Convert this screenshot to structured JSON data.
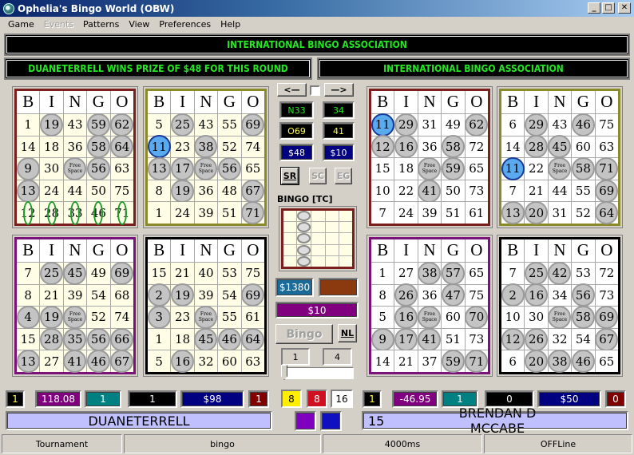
{
  "window": {
    "title": "Ophelia's Bingo World (OBW)",
    "controls": [
      "_",
      "□",
      "✕"
    ]
  },
  "menu": [
    {
      "label": "Game",
      "enabled": true
    },
    {
      "label": "Events",
      "enabled": false
    },
    {
      "label": "Patterns",
      "enabled": true
    },
    {
      "label": "View",
      "enabled": true
    },
    {
      "label": "Preferences",
      "enabled": true
    },
    {
      "label": "Help",
      "enabled": true
    }
  ],
  "banners": {
    "top": "INTERNATIONAL BINGO ASSOCIATION",
    "left": "DUANETERRELL   WINS PRIZE OF $48 FOR THIS ROUND",
    "right": "INTERNATIONAL BINGO ASSOCIATION"
  },
  "colors": {
    "banner_text": "#22e822",
    "card_dark_red": "#7a1e1e",
    "card_olive": "#8a8a2a",
    "card_purple": "#7a127a",
    "card_black": "#000000",
    "marked_ball": "#c4c4c4",
    "called_ball": "#5aaaf0"
  },
  "bingo_header": [
    "B",
    "I",
    "N",
    "G",
    "O"
  ],
  "free_space_label": "Free Space",
  "cards": [
    {
      "id": "left-1",
      "border": "#7a1e1e",
      "style": "cream",
      "rows": [
        [
          1,
          19,
          43,
          59,
          62
        ],
        [
          14,
          18,
          36,
          58,
          64
        ],
        [
          9,
          30,
          "FREE",
          56,
          63
        ],
        [
          13,
          24,
          44,
          50,
          75
        ],
        [
          12,
          28,
          33,
          46,
          71
        ]
      ],
      "marked": [
        [
          0,
          1
        ],
        [
          0,
          3
        ],
        [
          0,
          4
        ],
        [
          1,
          3
        ],
        [
          1,
          4
        ],
        [
          2,
          0
        ],
        [
          2,
          2
        ],
        [
          2,
          3
        ],
        [
          3,
          0
        ]
      ],
      "called": [],
      "winning_row": 4
    },
    {
      "id": "left-2",
      "border": "#8a8a2a",
      "style": "cream",
      "rows": [
        [
          5,
          25,
          43,
          55,
          69
        ],
        [
          11,
          23,
          38,
          52,
          74
        ],
        [
          13,
          17,
          "FREE",
          56,
          65
        ],
        [
          8,
          19,
          36,
          48,
          67
        ],
        [
          1,
          24,
          39,
          51,
          71
        ]
      ],
      "marked": [
        [
          0,
          1
        ],
        [
          0,
          4
        ],
        [
          1,
          2
        ],
        [
          2,
          0
        ],
        [
          2,
          1
        ],
        [
          2,
          2
        ],
        [
          2,
          3
        ],
        [
          3,
          1
        ],
        [
          3,
          4
        ],
        [
          4,
          4
        ]
      ],
      "called": [
        [
          1,
          0
        ]
      ],
      "winning_row": null
    },
    {
      "id": "left-3",
      "border": "#7a127a",
      "style": "cream",
      "rows": [
        [
          7,
          25,
          45,
          49,
          69
        ],
        [
          8,
          21,
          39,
          54,
          68
        ],
        [
          4,
          19,
          "FREE",
          52,
          74
        ],
        [
          15,
          28,
          35,
          56,
          66
        ],
        [
          13,
          27,
          41,
          46,
          67
        ]
      ],
      "marked": [
        [
          0,
          1
        ],
        [
          0,
          2
        ],
        [
          0,
          4
        ],
        [
          2,
          0
        ],
        [
          2,
          1
        ],
        [
          2,
          2
        ],
        [
          3,
          1
        ],
        [
          3,
          2
        ],
        [
          3,
          3
        ],
        [
          3,
          4
        ],
        [
          4,
          0
        ],
        [
          4,
          2
        ],
        [
          4,
          3
        ],
        [
          4,
          4
        ]
      ],
      "called": [],
      "winning_row": null
    },
    {
      "id": "left-4",
      "border": "#000000",
      "style": "cream",
      "rows": [
        [
          15,
          21,
          40,
          53,
          75
        ],
        [
          2,
          19,
          39,
          54,
          69
        ],
        [
          3,
          23,
          "FREE",
          55,
          61
        ],
        [
          1,
          18,
          45,
          46,
          64
        ],
        [
          5,
          16,
          32,
          60,
          63
        ]
      ],
      "marked": [
        [
          1,
          0
        ],
        [
          1,
          1
        ],
        [
          1,
          4
        ],
        [
          2,
          0
        ],
        [
          2,
          2
        ],
        [
          3,
          2
        ],
        [
          3,
          3
        ],
        [
          3,
          4
        ],
        [
          4,
          1
        ]
      ],
      "called": [],
      "winning_row": null
    },
    {
      "id": "right-1",
      "border": "#7a1e1e",
      "style": "white",
      "rows": [
        [
          11,
          29,
          31,
          49,
          62
        ],
        [
          12,
          16,
          36,
          58,
          72
        ],
        [
          15,
          18,
          "FREE",
          59,
          65
        ],
        [
          10,
          22,
          41,
          50,
          73
        ],
        [
          7,
          24,
          39,
          51,
          61
        ]
      ],
      "marked": [
        [
          0,
          1
        ],
        [
          0,
          4
        ],
        [
          1,
          0
        ],
        [
          1,
          1
        ],
        [
          1,
          3
        ],
        [
          2,
          2
        ],
        [
          2,
          3
        ],
        [
          3,
          2
        ]
      ],
      "called": [
        [
          0,
          0
        ]
      ],
      "winning_row": null
    },
    {
      "id": "right-2",
      "border": "#8a8a2a",
      "style": "white",
      "rows": [
        [
          6,
          29,
          43,
          46,
          75
        ],
        [
          14,
          28,
          45,
          60,
          63
        ],
        [
          11,
          22,
          "FREE",
          58,
          71
        ],
        [
          7,
          21,
          44,
          55,
          69
        ],
        [
          13,
          20,
          31,
          52,
          64
        ]
      ],
      "marked": [
        [
          0,
          1
        ],
        [
          0,
          3
        ],
        [
          1,
          1
        ],
        [
          1,
          2
        ],
        [
          2,
          2
        ],
        [
          2,
          3
        ],
        [
          2,
          4
        ],
        [
          3,
          4
        ],
        [
          4,
          0
        ],
        [
          4,
          1
        ],
        [
          4,
          4
        ]
      ],
      "called": [
        [
          2,
          0
        ]
      ],
      "winning_row": null
    },
    {
      "id": "right-3",
      "border": "#7a127a",
      "style": "white",
      "rows": [
        [
          1,
          27,
          38,
          57,
          65
        ],
        [
          8,
          26,
          36,
          47,
          75
        ],
        [
          5,
          16,
          "FREE",
          60,
          70
        ],
        [
          9,
          17,
          41,
          51,
          73
        ],
        [
          14,
          21,
          37,
          59,
          71
        ]
      ],
      "marked": [
        [
          0,
          2
        ],
        [
          0,
          3
        ],
        [
          1,
          1
        ],
        [
          1,
          3
        ],
        [
          2,
          1
        ],
        [
          2,
          2
        ],
        [
          2,
          4
        ],
        [
          3,
          0
        ],
        [
          3,
          1
        ],
        [
          3,
          2
        ],
        [
          4,
          3
        ],
        [
          4,
          4
        ]
      ],
      "called": [],
      "winning_row": null
    },
    {
      "id": "right-4",
      "border": "#000000",
      "style": "white",
      "rows": [
        [
          7,
          25,
          42,
          53,
          72
        ],
        [
          2,
          16,
          34,
          56,
          73
        ],
        [
          10,
          30,
          "FREE",
          58,
          69
        ],
        [
          12,
          26,
          32,
          54,
          67
        ],
        [
          6,
          20,
          38,
          46,
          65
        ]
      ],
      "marked": [
        [
          0,
          1
        ],
        [
          0,
          2
        ],
        [
          1,
          0
        ],
        [
          1,
          1
        ],
        [
          1,
          3
        ],
        [
          2,
          2
        ],
        [
          2,
          3
        ],
        [
          2,
          4
        ],
        [
          3,
          0
        ],
        [
          3,
          1
        ],
        [
          3,
          4
        ],
        [
          4,
          1
        ],
        [
          4,
          2
        ],
        [
          4,
          3
        ]
      ],
      "called": [],
      "winning_row": null
    }
  ],
  "center": {
    "prev_button": "<—",
    "next_button": "—>",
    "checkbox_checked": false,
    "current_call": "N33",
    "call_count": "34",
    "previous_call": "O69",
    "previous_count": "41",
    "prize": "$48",
    "bet": "$10",
    "buttons": {
      "sr": "SR",
      "sc": "SC",
      "eg": "EG"
    },
    "pattern_label": "BINGO [TC]",
    "pattern_column": 1,
    "jackpot": "$1380",
    "jackpot_swatch": "#8b3a0f",
    "card_price": "$10",
    "bingo_button": "Bingo",
    "nl_button": "NL",
    "spin_left": "1",
    "spin_right": "4",
    "slider_value": 0
  },
  "player_left": {
    "stats": [
      {
        "value": "1",
        "bg": "#000000",
        "fg": "#ffff40"
      },
      {
        "value": "118.08",
        "bg": "#800080",
        "fg": "#ffffff"
      },
      {
        "value": "1",
        "bg": "#008080",
        "fg": "#ffffff"
      },
      {
        "value": "1",
        "bg": "#000000",
        "fg": "#ffffff"
      },
      {
        "value": "$98",
        "bg": "#000080",
        "fg": "#ffffff"
      },
      {
        "value": "1",
        "bg": "#800000",
        "fg": "#ffffff"
      }
    ],
    "name": "DUANETERRELL"
  },
  "center_bottom": {
    "counters": [
      {
        "value": "8",
        "bg": "#ffee00",
        "fg": "#000000"
      },
      {
        "value": "8",
        "bg": "#d01020",
        "fg": "#ffffff"
      },
      {
        "value": "16",
        "bg": "#ffffff",
        "fg": "#000000"
      }
    ],
    "swatches": [
      "#8000c0",
      "#1010c0"
    ]
  },
  "player_right": {
    "stats": [
      {
        "value": "1",
        "bg": "#000000",
        "fg": "#ffff40"
      },
      {
        "value": "-46.95",
        "bg": "#800080",
        "fg": "#ffffff"
      },
      {
        "value": "1",
        "bg": "#008080",
        "fg": "#ffffff"
      },
      {
        "value": "0",
        "bg": "#000000",
        "fg": "#ffffff"
      },
      {
        "value": "$50",
        "bg": "#000080",
        "fg": "#ffffff"
      },
      {
        "value": "0",
        "bg": "#800000",
        "fg": "#ffffff"
      }
    ],
    "seat": "15",
    "name": "BRENDAN D MCCABE"
  },
  "statusbar": [
    "Tournament",
    "bingo",
    "4000ms",
    "OFFLine"
  ]
}
